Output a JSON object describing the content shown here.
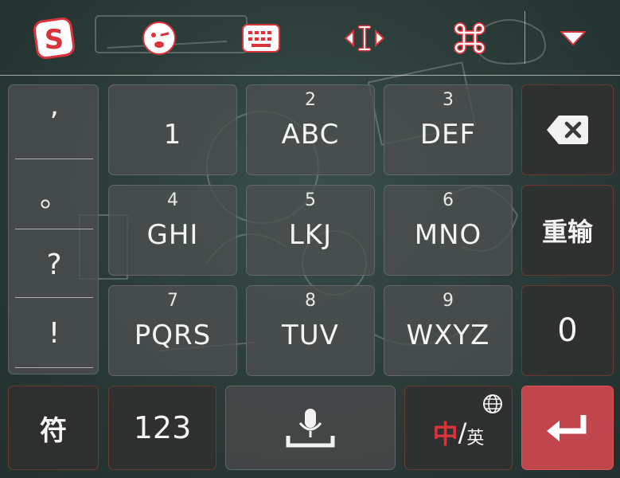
{
  "toolbar": {
    "logo_letter": "S",
    "icons": [
      "sogou-logo-icon",
      "emoji-icon",
      "keyboard-icon",
      "cursor-move-icon",
      "command-icon",
      "collapse-icon"
    ]
  },
  "keyboard": {
    "punctuation": [
      "’",
      "。",
      "?",
      "!"
    ],
    "keys": [
      {
        "num": "",
        "label": "1"
      },
      {
        "num": "2",
        "label": "ABC"
      },
      {
        "num": "3",
        "label": "DEF"
      },
      {
        "num": "4",
        "label": "GHI"
      },
      {
        "num": "5",
        "label": "LKJ"
      },
      {
        "num": "6",
        "label": "MNO"
      },
      {
        "num": "7",
        "label": "PQRS"
      },
      {
        "num": "8",
        "label": "TUV"
      },
      {
        "num": "9",
        "label": "WXYZ"
      }
    ],
    "reinput_label": "重输",
    "zero_label": "0",
    "symbol_label": "符",
    "numeric_label": "123",
    "lang_cn": "中",
    "lang_sep": "/",
    "lang_en": "英"
  },
  "colors": {
    "accent_red": "#c1464b",
    "logo_red": "#d9343c"
  }
}
